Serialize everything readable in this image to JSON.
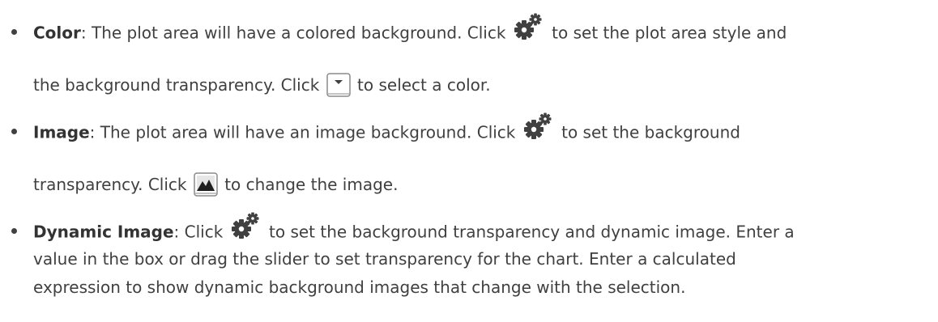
{
  "items": [
    {
      "term": "Color",
      "line1_pre": ": The plot area will have a colored background. Click ",
      "line1_post": " to set the plot area style and",
      "line2_pre": "the background transparency. Click ",
      "line2_post": " to select a color.",
      "icons": [
        "gear-icon",
        "dropdown-icon"
      ]
    },
    {
      "term": "Image",
      "line1_pre": ": The plot area will have an image background. Click ",
      "line1_post": " to set the background",
      "line2_pre": "transparency. Click ",
      "line2_post": " to change the image.",
      "icons": [
        "gear-icon",
        "image-icon"
      ]
    },
    {
      "term": "Dynamic Image",
      "line1_pre": ": Click ",
      "line1_post": " to set the background transparency and dynamic image. Enter a",
      "line2": "value in the box or drag the slider to set transparency for the chart. Enter a calculated",
      "line3": "expression to show dynamic background images that change with the selection.",
      "icons": [
        "gear-icon"
      ]
    }
  ]
}
